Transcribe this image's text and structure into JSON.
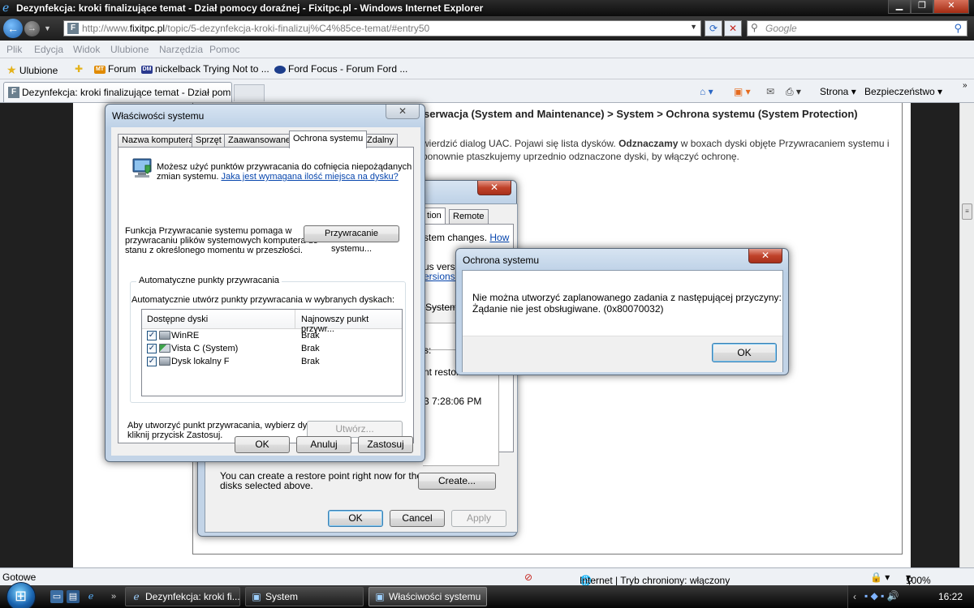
{
  "window": {
    "title": "Dezynfekcja: kroki finalizujące temat - Dział pomocy doraźnej - Fixitpc.pl - Windows Internet Explorer"
  },
  "address": {
    "prefix": "http://www.",
    "host": "fixitpc.pl",
    "path": "/topic/5-dezynfekcja-kroki-finalizuj%C4%85ce-temat/#entry50",
    "search_placeholder": "Google"
  },
  "menu": [
    "Plik",
    "Edycja",
    "Widok",
    "Ulubione",
    "Narzędzia",
    "Pomoc"
  ],
  "favorites": {
    "label": "Ulubione",
    "items": [
      "Forum",
      "nickelback Trying Not to ...",
      "Ford Focus - Forum Ford ..."
    ]
  },
  "tab": {
    "label": "Dezynfekcja: kroki finalizujące temat - Dział pom..."
  },
  "commands": {
    "page": "Strona",
    "safety": "Bezpieczeństwo"
  },
  "article": {
    "heading": "serwacja (System and Maintenance) > System > Ochrona systemu (System Protection)",
    "line1_a": "wierdzić dialog UAC. Pojawi się lista dysków. ",
    "line1_b": "Odznaczamy",
    "line1_c": " w boxach dyski objęte Przywracaniem systemu i",
    "line2": "ponownie ptaszkujemy uprzednio odznaczone dyski, by włączyć ochronę."
  },
  "system_dialog": {
    "tab_fragment": "tion",
    "tab_remote": "Remote",
    "frag_changes": "stem changes. ",
    "frag_how": "How",
    "frag_versio": "us versio",
    "frag_versions": "ersions?",
    "frag_system_f": "System F",
    "frag_s": "s:",
    "frag_restore": "nt restore",
    "frag_time": "3 7:28:06 PM",
    "create_text_1": "You can create a restore point right now for the",
    "create_text_2": "disks selected above.",
    "create_btn": "Create...",
    "ok": "OK",
    "cancel": "Cancel",
    "apply": "Apply"
  },
  "props_dialog": {
    "title": "Właściwości systemu",
    "tabs": [
      "Nazwa komputera",
      "Sprzęt",
      "Zaawansowane",
      "Ochrona systemu",
      "Zdalny"
    ],
    "intro_1": "Możesz użyć punktów przywracania do cofnięcia niepożądanych",
    "intro_2": "zmian systemu. ",
    "intro_link": "Jaka jest wymagana ilość miejsca na dysku?",
    "restore_desc_1": "Funkcja Przywracanie systemu pomaga w",
    "restore_desc_2": "przywracaniu plików systemowych komputera do",
    "restore_desc_3": "stanu z określonego momentu w przeszłości.",
    "restore_btn": "Przywracanie systemu...",
    "group_label": "Automatyczne punkty przywracania",
    "group_desc": "Automatycznie utwórz punkty przywracania w wybranych dyskach:",
    "col_disks": "Dostępne dyski",
    "col_latest": "Najnowszy punkt przywr...",
    "disks": [
      {
        "name": "WinRE",
        "value": "Brak"
      },
      {
        "name": "Vista C (System)",
        "value": "Brak"
      },
      {
        "name": "Dysk lokalny F",
        "value": "Brak"
      }
    ],
    "create_desc_1": "Aby utworzyć punkt przywracania, wybierz dysk i",
    "create_desc_2": "kliknij przycisk Zastosuj.",
    "create_btn": "Utwórz...",
    "ok": "OK",
    "cancel": "Anuluj",
    "apply": "Zastosuj"
  },
  "error_dialog": {
    "title": "Ochrona systemu",
    "message_1": "Nie można utworzyć zaplanowanego zadania z następującej przyczyny:",
    "message_2": "Żądanie nie jest obsługiwane. (0x80070032)",
    "ok": "OK"
  },
  "status": {
    "left": "Gotowe",
    "zone": "Internet | Tryb chroniony: włączony",
    "zoom": "100%"
  },
  "taskbar": {
    "buttons": [
      "Dezynfekcja: kroki fi...",
      "System",
      "Właściwości systemu"
    ],
    "clock": "16:22"
  }
}
